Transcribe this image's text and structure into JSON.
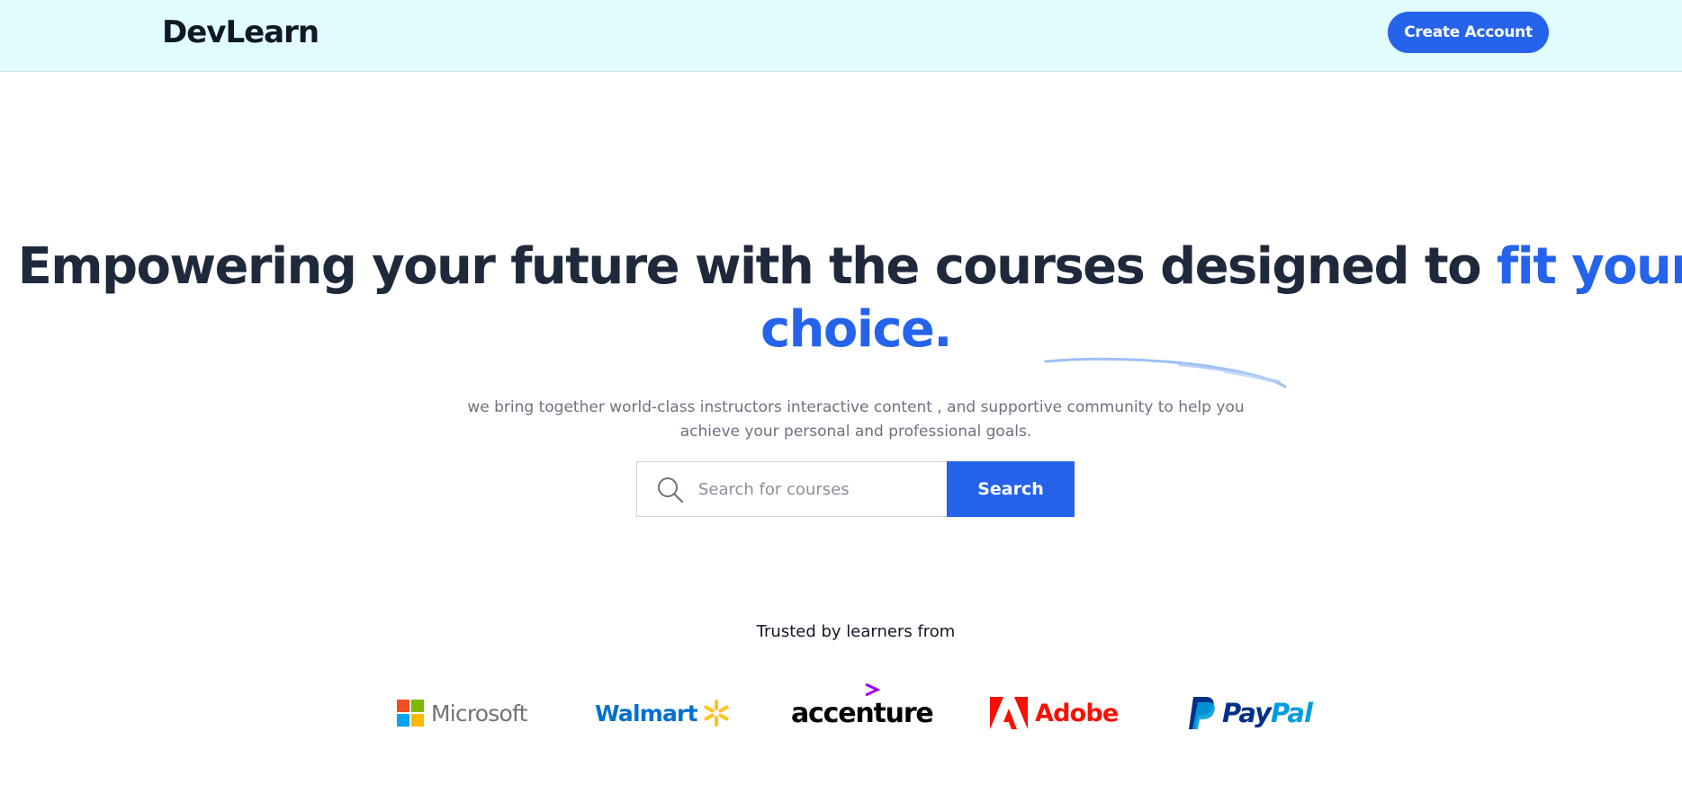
{
  "header": {
    "logo": "DevLearn",
    "create_account_label": "Create Account"
  },
  "hero": {
    "title_main": "Empowering your future with the courses designed to ",
    "title_accent": "fit your choice.",
    "subtitle_line1": "we bring together world-class instructors interactive content , and supportive community to help you",
    "subtitle_line2": "achieve your personal and professional goals."
  },
  "search": {
    "placeholder": "Search for courses",
    "value": "",
    "button_label": "Search",
    "icon": "search-icon"
  },
  "trusted": {
    "heading": "Trusted by learners from",
    "companies": [
      {
        "name": "Microsoft",
        "icon": "microsoft-logo"
      },
      {
        "name": "Walmart",
        "icon": "walmart-spark"
      },
      {
        "name": "accenture",
        "icon": "accenture-chevron"
      },
      {
        "name": "Adobe",
        "icon": "adobe-logo"
      },
      {
        "name": "PayPal",
        "icon": "paypal-logo"
      }
    ]
  },
  "colors": {
    "header_bg": "#e0fcfd",
    "primary": "#2563eb",
    "title": "#1e293b",
    "muted_text": "#6b7280",
    "underline_stroke": "#9ec0f5"
  }
}
